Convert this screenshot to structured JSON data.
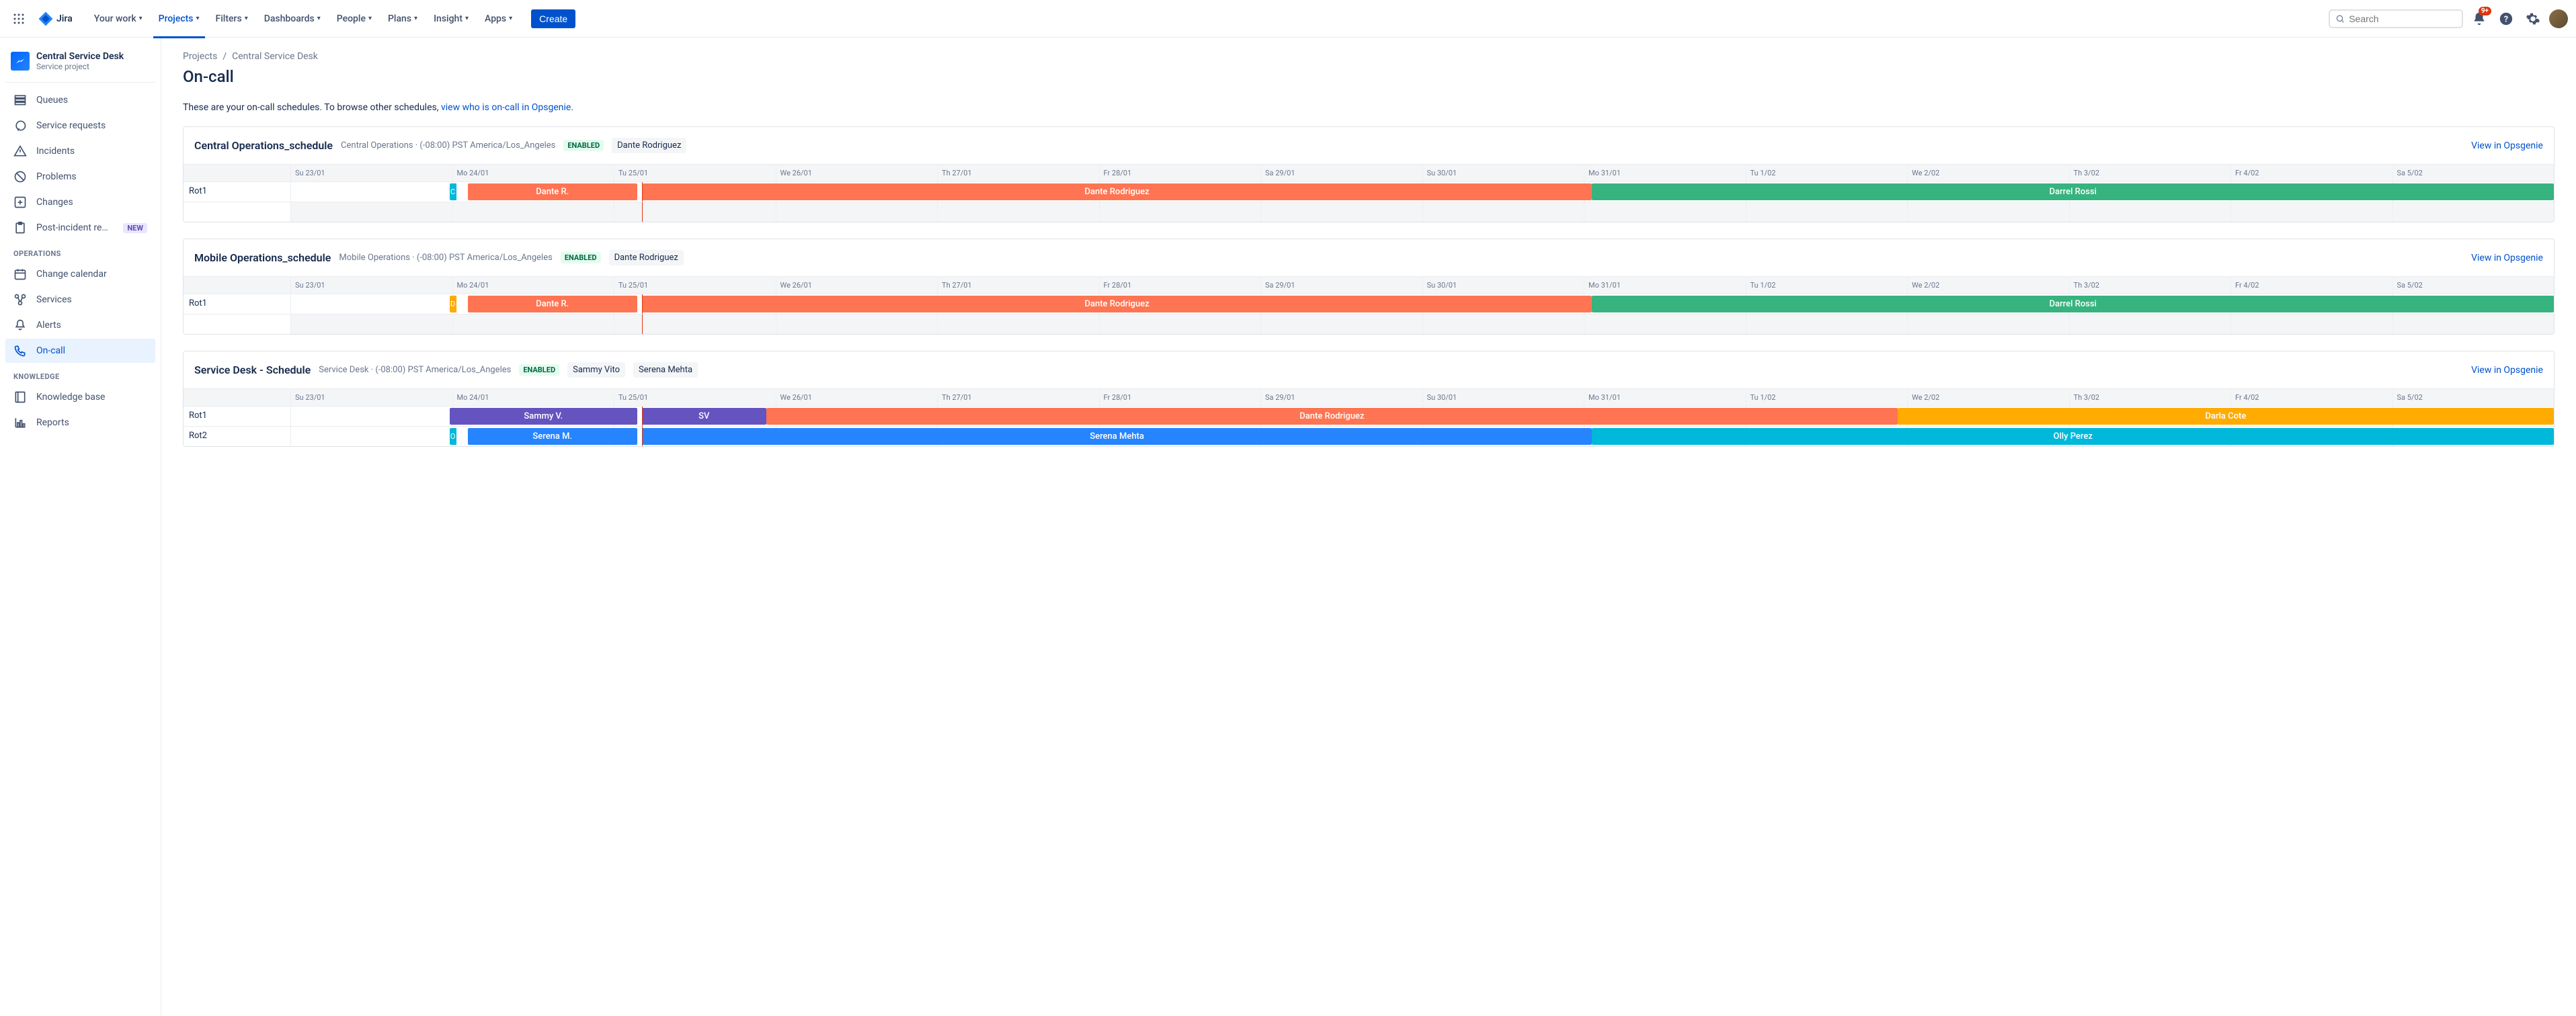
{
  "nav": {
    "logo": "Jira",
    "items": [
      {
        "label": "Your work"
      },
      {
        "label": "Projects",
        "active": true
      },
      {
        "label": "Filters"
      },
      {
        "label": "Dashboards"
      },
      {
        "label": "People"
      },
      {
        "label": "Plans"
      },
      {
        "label": "Insight"
      },
      {
        "label": "Apps"
      }
    ],
    "create": "Create",
    "search_placeholder": "Search",
    "notification_badge": "9+"
  },
  "sidebar": {
    "project_name": "Central Service Desk",
    "project_type": "Service project",
    "items": [
      {
        "id": "queues",
        "label": "Queues",
        "icon": "queues-icon"
      },
      {
        "id": "service-requests",
        "label": "Service requests",
        "icon": "chat-icon"
      },
      {
        "id": "incidents",
        "label": "Incidents",
        "icon": "warning-icon"
      },
      {
        "id": "problems",
        "label": "Problems",
        "icon": "problem-icon"
      },
      {
        "id": "changes",
        "label": "Changes",
        "icon": "plus-icon"
      },
      {
        "id": "post-incident",
        "label": "Post-incident re…",
        "icon": "clipboard-icon",
        "badge": "NEW"
      }
    ],
    "operations_label": "OPERATIONS",
    "ops_items": [
      {
        "id": "change-calendar",
        "label": "Change calendar",
        "icon": "calendar-icon"
      },
      {
        "id": "services",
        "label": "Services",
        "icon": "services-icon"
      },
      {
        "id": "alerts",
        "label": "Alerts",
        "icon": "bell-icon"
      },
      {
        "id": "on-call",
        "label": "On-call",
        "icon": "phone-icon",
        "active": true
      }
    ],
    "knowledge_label": "KNOWLEDGE",
    "knowledge_items": [
      {
        "id": "knowledge-base",
        "label": "Knowledge base",
        "icon": "book-icon"
      },
      {
        "id": "reports",
        "label": "Reports",
        "icon": "chart-icon"
      }
    ]
  },
  "breadcrumb": {
    "root": "Projects",
    "project": "Central Service Desk"
  },
  "page_title": "On-call",
  "intro": {
    "text": "These are your on-call schedules. To browse other schedules, ",
    "link": "view who is on-call in Opsgenie",
    "suffix": "."
  },
  "timeline_days": [
    "Su 23/01",
    "Mo 24/01",
    "Tu 25/01",
    "We 26/01",
    "Th 27/01",
    "Fr 28/01",
    "Sa 29/01",
    "Su 30/01",
    "Mo 31/01",
    "Tu 1/02",
    "We 2/02",
    "Th 3/02",
    "Fr 4/02",
    "Sa 5/02"
  ],
  "now_position_pct": 15.5,
  "schedules": [
    {
      "name": "Central Operations_schedule",
      "meta": "Central Operations · (-08:00) PST America/Los_Angeles",
      "enabled": "ENABLED",
      "participants": [
        "Dante Rodriguez"
      ],
      "view_link": "View in Opsgenie",
      "rotations": [
        {
          "label": "Rot1",
          "stub": {
            "label": "C",
            "color": "#00B8D9",
            "left_pct": 7.0
          },
          "bars": [
            {
              "label": "Dante R.",
              "color": "#FF7452",
              "left_pct": 7.8,
              "width_pct": 7.5
            },
            {
              "label": "Dante Rodriguez",
              "color": "#FF7452",
              "left_pct": 15.5,
              "width_pct": 42.0
            },
            {
              "label": "Darrel Rossi",
              "color": "#36B37E",
              "left_pct": 57.5,
              "width_pct": 42.5
            }
          ]
        }
      ],
      "padding_rows": 1
    },
    {
      "name": "Mobile Operations_schedule",
      "meta": "Mobile Operations · (-08:00) PST America/Los_Angeles",
      "enabled": "ENABLED",
      "participants": [
        "Dante Rodriguez"
      ],
      "view_link": "View in Opsgenie",
      "rotations": [
        {
          "label": "Rot1",
          "stub": {
            "label": "D",
            "color": "#FFAB00",
            "left_pct": 7.0
          },
          "bars": [
            {
              "label": "Dante R.",
              "color": "#FF7452",
              "left_pct": 7.8,
              "width_pct": 7.5
            },
            {
              "label": "Dante Rodriguez",
              "color": "#FF7452",
              "left_pct": 15.5,
              "width_pct": 42.0
            },
            {
              "label": "Darrel Rossi",
              "color": "#36B37E",
              "left_pct": 57.5,
              "width_pct": 42.5
            }
          ]
        }
      ],
      "padding_rows": 1
    },
    {
      "name": "Service Desk - Schedule",
      "meta": "Service Desk · (-08:00) PST America/Los_Angeles",
      "enabled": "ENABLED",
      "participants": [
        "Sammy Vito",
        "Serena Mehta"
      ],
      "view_link": "View in Opsgenie",
      "rotations": [
        {
          "label": "Rot1",
          "bars": [
            {
              "label": "Sammy V.",
              "color": "#6554C0",
              "left_pct": 7.0,
              "width_pct": 8.3
            },
            {
              "label": "SV",
              "color": "#6554C0",
              "left_pct": 15.5,
              "width_pct": 5.5
            },
            {
              "label": "Dante Rodriguez",
              "color": "#FF7452",
              "left_pct": 21.0,
              "width_pct": 50.0
            },
            {
              "label": "Darla Cote",
              "color": "#FFAB00",
              "left_pct": 71.0,
              "width_pct": 29.0
            }
          ]
        },
        {
          "label": "Rot2",
          "stub": {
            "label": "O",
            "color": "#00B8D9",
            "left_pct": 7.0
          },
          "bars": [
            {
              "label": "Serena M.",
              "color": "#2684FF",
              "left_pct": 7.8,
              "width_pct": 7.5
            },
            {
              "label": "Serena Mehta",
              "color": "#2684FF",
              "left_pct": 15.5,
              "width_pct": 42.0
            },
            {
              "label": "Olly Perez",
              "color": "#00B8D9",
              "left_pct": 57.5,
              "width_pct": 42.5
            }
          ]
        }
      ],
      "padding_rows": 0
    }
  ]
}
